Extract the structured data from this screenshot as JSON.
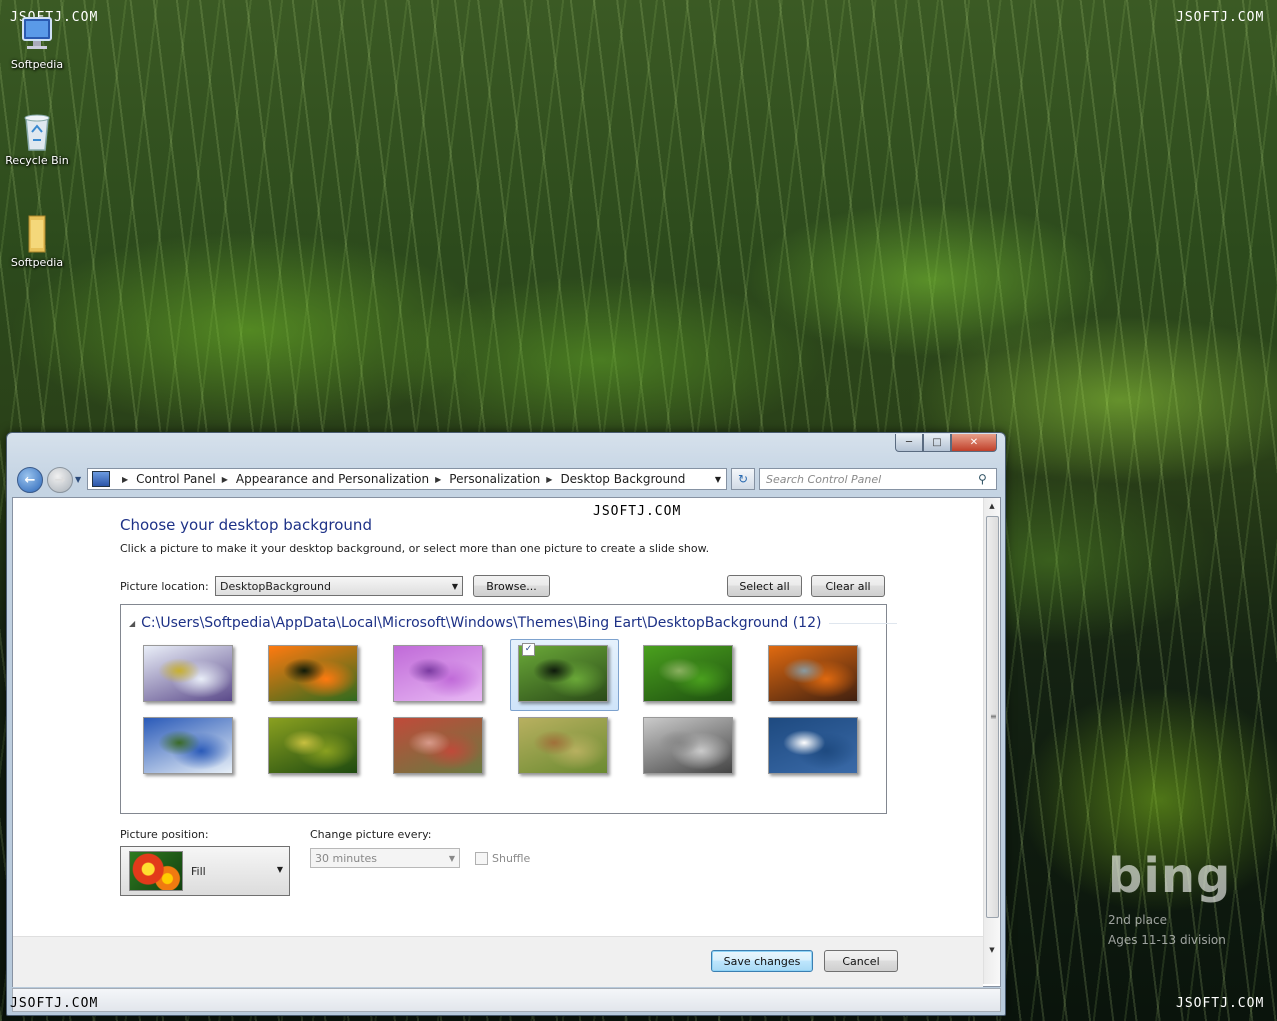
{
  "watermark": {
    "top_left": "JSOFTJ.COM",
    "top_right": "JSOFTJ.COM",
    "center": "JSOFTJ.COM",
    "bottom_left": "JSOFTJ.COM",
    "bottom_right": "JSOFTJ.COM"
  },
  "desktop": {
    "icons": [
      {
        "label": "Softpedia",
        "icon": "computer-icon"
      },
      {
        "label": "Recycle Bin",
        "icon": "recycle-bin-icon"
      },
      {
        "label": "Softpedia",
        "icon": "folder-icon"
      }
    ],
    "bing": {
      "logo": "bing",
      "line1": "2nd place",
      "line2": "Ages 11-13 division"
    }
  },
  "window": {
    "address": {
      "crumbs": [
        "Control Panel",
        "Appearance and Personalization",
        "Personalization",
        "Desktop Background"
      ]
    },
    "search_placeholder": "Search Control Panel",
    "title": "Choose your desktop background",
    "description": "Click a picture to make it your desktop background, or select more than one picture to create a slide show.",
    "picture_location": {
      "label": "Picture location:",
      "value": "DesktopBackground",
      "browse": "Browse...",
      "select_all": "Select all",
      "clear_all": "Clear all"
    },
    "gallery": {
      "group_header": "C:\\Users\\Softpedia\\AppData\\Local\\Microsoft\\Windows\\Themes\\Bing Eart\\DesktopBackground (12)",
      "selected_index": 3,
      "thumbnails": [
        {
          "name": "passion-flower",
          "colors": [
            "#e9eef8",
            "#5b4a8a",
            "#c8b030"
          ]
        },
        {
          "name": "orange-butterfly",
          "colors": [
            "#ff7a10",
            "#2f6a1e",
            "#101a08"
          ]
        },
        {
          "name": "purple-dew",
          "colors": [
            "#c06ad8",
            "#e8b8f4",
            "#7a3aa0"
          ]
        },
        {
          "name": "lily-pads",
          "colors": [
            "#6aa838",
            "#2a4a18",
            "#0e1a0c"
          ]
        },
        {
          "name": "frog",
          "colors": [
            "#4aa01e",
            "#1e5010",
            "#8ab060"
          ]
        },
        {
          "name": "fungus",
          "colors": [
            "#e06a10",
            "#402010",
            "#8a9aa0"
          ]
        },
        {
          "name": "mountain-lake",
          "colors": [
            "#2a5ab8",
            "#e8f0f8",
            "#3a6a28"
          ]
        },
        {
          "name": "grasshopper",
          "colors": [
            "#8aa020",
            "#1e4a10",
            "#c8c040"
          ]
        },
        {
          "name": "red-flowers",
          "colors": [
            "#c04a3a",
            "#6a7a40",
            "#d89a8a"
          ]
        },
        {
          "name": "snail",
          "colors": [
            "#b8b060",
            "#6a8a30",
            "#a0703a"
          ]
        },
        {
          "name": "rocks",
          "colors": [
            "#cacaca",
            "#444444",
            "#888888"
          ]
        },
        {
          "name": "whale",
          "colors": [
            "#1e4a80",
            "#3a6aa8",
            "#ffffff"
          ]
        }
      ]
    },
    "picture_position": {
      "label": "Picture position:",
      "value": "Fill"
    },
    "change_picture": {
      "label": "Change picture every:",
      "value": "30 minutes",
      "shuffle": "Shuffle"
    },
    "buttons": {
      "save": "Save changes",
      "cancel": "Cancel"
    }
  }
}
